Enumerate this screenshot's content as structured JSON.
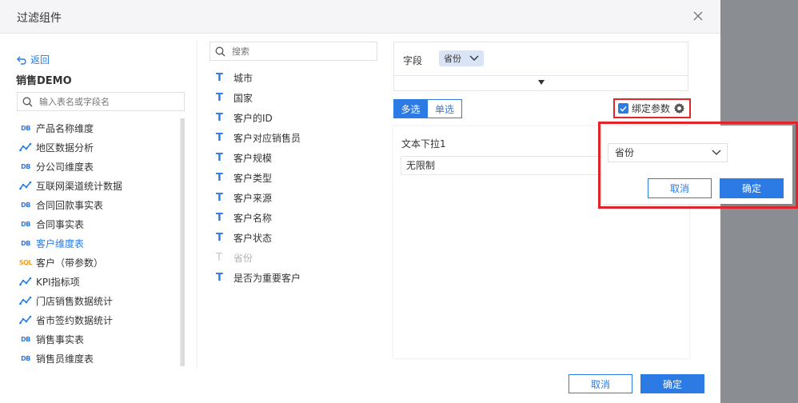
{
  "dialog": {
    "title": "过滤组件",
    "close_icon": "close-icon"
  },
  "left": {
    "back_label": "返回",
    "package_name": "销售DEMO",
    "search_placeholder": "输入表名或字段名",
    "tables": [
      {
        "label": "产品名称维度",
        "icon": "db-icon"
      },
      {
        "label": "地区数据分析",
        "icon": "line-chart-icon"
      },
      {
        "label": "分公司维度表",
        "icon": "db-icon"
      },
      {
        "label": "互联网渠道统计数据",
        "icon": "line-chart-icon"
      },
      {
        "label": "合同回款事实表",
        "icon": "db-icon"
      },
      {
        "label": "合同事实表",
        "icon": "db-icon"
      },
      {
        "label": "客户维度表",
        "icon": "db-icon",
        "active": true
      },
      {
        "label": "客户（带参数）",
        "icon": "sql-icon"
      },
      {
        "label": "KPI指标项",
        "icon": "line-chart-icon"
      },
      {
        "label": "门店销售数据统计",
        "icon": "line-chart-icon"
      },
      {
        "label": "省市签约数据统计",
        "icon": "line-chart-icon"
      },
      {
        "label": "销售事实表",
        "icon": "db-icon"
      },
      {
        "label": "销售员维度表",
        "icon": "db-icon"
      }
    ]
  },
  "middle": {
    "search_placeholder": "搜索",
    "fields": [
      {
        "label": "城市",
        "type": "T"
      },
      {
        "label": "国家",
        "type": "T"
      },
      {
        "label": "客户的ID",
        "type": "T"
      },
      {
        "label": "客户对应销售员",
        "type": "T"
      },
      {
        "label": "客户规模",
        "type": "T"
      },
      {
        "label": "客户类型",
        "type": "T"
      },
      {
        "label": "客户来源",
        "type": "T"
      },
      {
        "label": "客户名称",
        "type": "T"
      },
      {
        "label": "客户状态",
        "type": "T"
      },
      {
        "label": "省份",
        "type": "T",
        "disabled": true
      },
      {
        "label": "是否为重要客户",
        "type": "T"
      }
    ]
  },
  "right": {
    "field_label": "字段",
    "field_tag": "省份",
    "mode_multi": "多选",
    "mode_single": "单选",
    "bind_label": "绑定参数",
    "bind_checked": true,
    "preview_title": "文本下拉1",
    "preview_value": "无限制"
  },
  "popup": {
    "select_value": "省份",
    "cancel": "取消",
    "ok": "确定"
  },
  "footer": {
    "cancel": "取消",
    "ok": "确定"
  },
  "colors": {
    "accent": "#2c7be5",
    "highlight": "#e0262b",
    "sql": "#f0a020"
  }
}
